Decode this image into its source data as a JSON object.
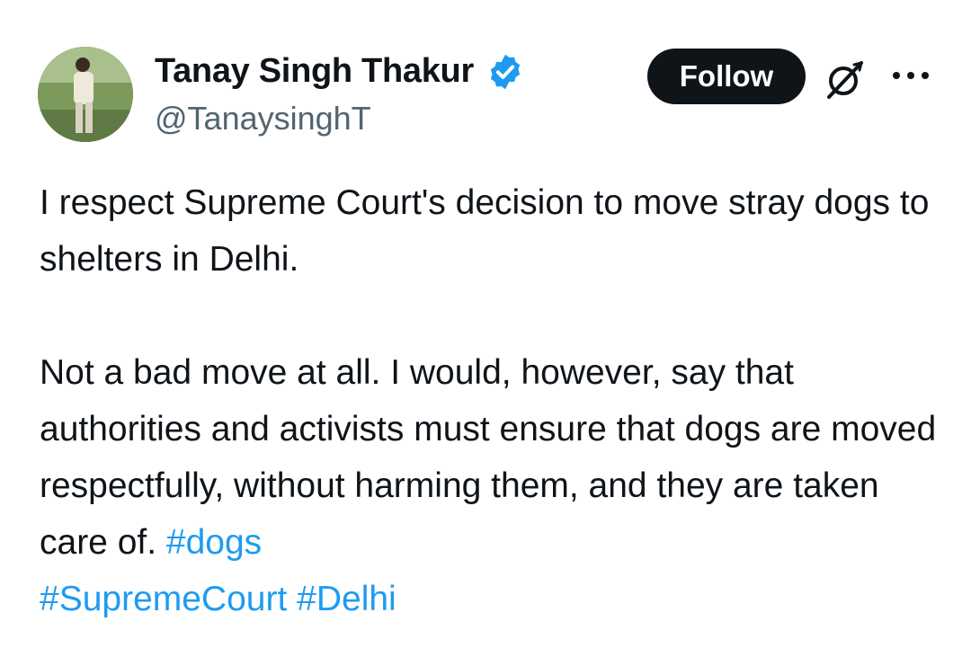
{
  "author": {
    "name": "Tanay Singh Thakur",
    "handle": "@TanaysinghT",
    "verified": true,
    "verified_color": "#1d9bf0"
  },
  "actions": {
    "follow_label": "Follow",
    "grok_icon": "grok-icon",
    "more_icon": "more-horizontal-icon"
  },
  "tweet": {
    "paragraph1": "I respect Supreme Court's decision to move stray dogs to shelters in Delhi.",
    "paragraph2_text": "Not a bad move at all. I would, however, say that authorities and activists must ensure that dogs are moved respectfully, without harming them, and they are taken care of.",
    "hashtags": [
      "#dogs",
      "#SupremeCourt",
      "#Delhi"
    ],
    "hashtag_color": "#1d9bf0"
  }
}
